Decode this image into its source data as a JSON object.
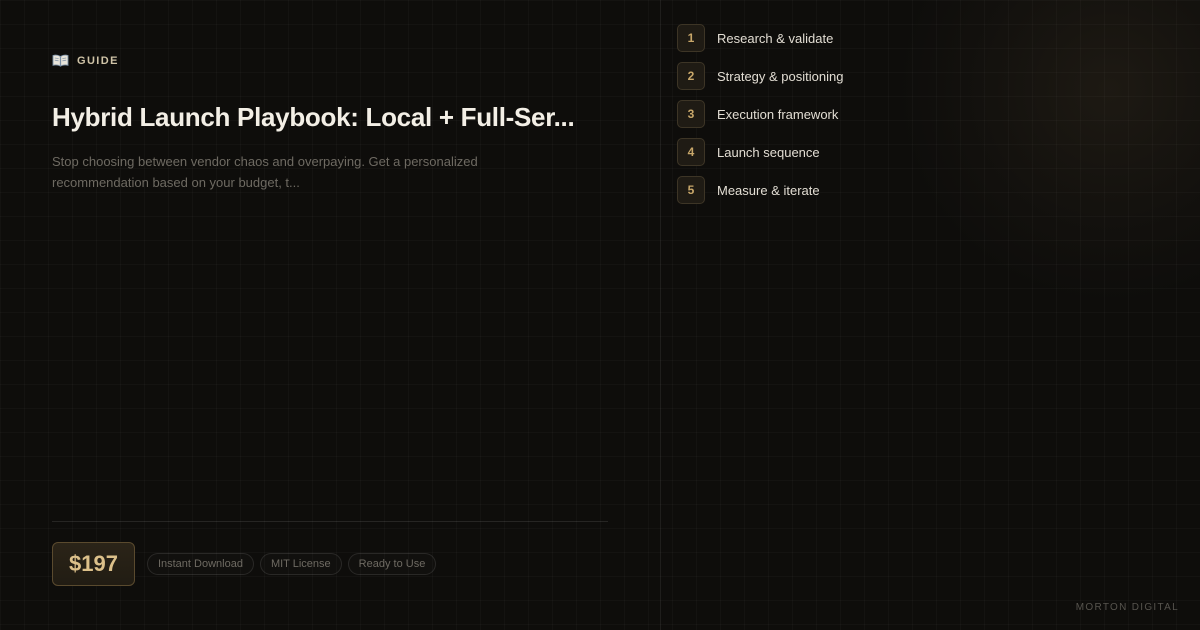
{
  "card": {
    "category": {
      "icon": "open-book-icon",
      "label": "GUIDE"
    },
    "title": "Hybrid Launch Playbook: Local + Full-Ser...",
    "description": "Stop choosing between vendor chaos and overpaying. Get a personalized recommendation based on your budget, t...",
    "price": "$197",
    "tags": [
      "Instant Download",
      "MIT License",
      "Ready to Use"
    ]
  },
  "steps": [
    {
      "number": "1",
      "label": "Research & validate"
    },
    {
      "number": "2",
      "label": "Strategy & positioning"
    },
    {
      "number": "3",
      "label": "Execution framework"
    },
    {
      "number": "4",
      "label": "Launch sequence"
    },
    {
      "number": "5",
      "label": "Measure & iterate"
    }
  ],
  "brand": "MORTON DIGITAL",
  "colors": {
    "background": "#0e0d0b",
    "accent_gold": "#dcc08a",
    "step_number": "#c8a76a",
    "title": "#f3efe6",
    "muted_text": "#6e6a62"
  }
}
